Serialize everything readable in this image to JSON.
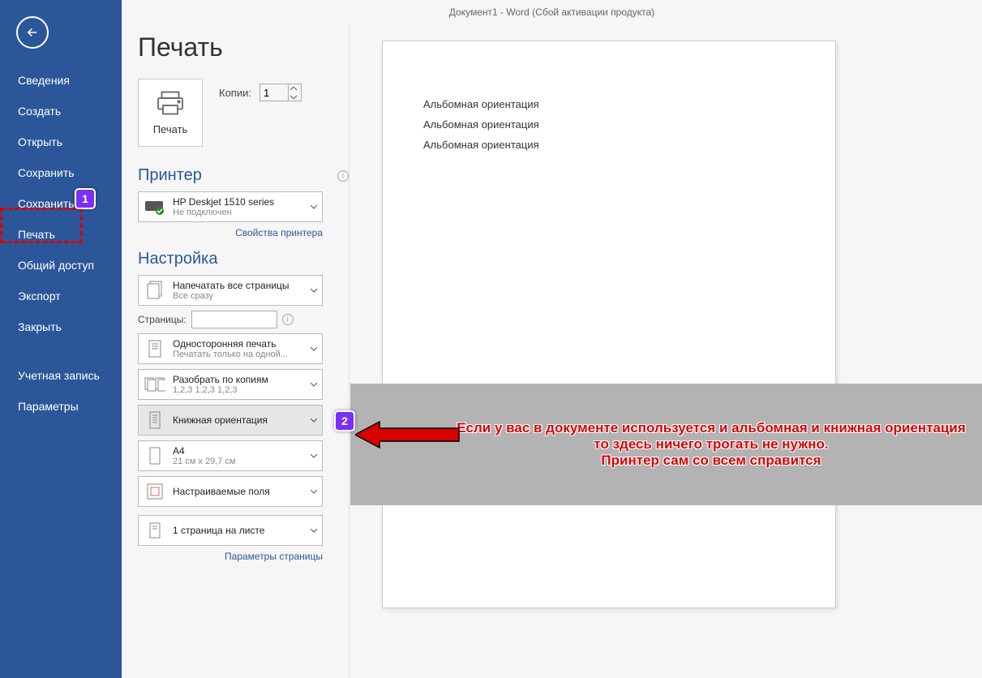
{
  "titlebar": "Документ1 - Word (Сбой активации продукта)",
  "sidebar": {
    "items": [
      "Сведения",
      "Создать",
      "Открыть",
      "Сохранить",
      "Сохранить и",
      "Печать",
      "Общий доступ",
      "Экспорт",
      "Закрыть",
      "Учетная запись",
      "Параметры"
    ]
  },
  "page": {
    "title": "Печать"
  },
  "print_button": {
    "label": "Печать"
  },
  "copies": {
    "label": "Копии:",
    "value": "1"
  },
  "printer": {
    "heading": "Принтер",
    "name": "HP Deskjet 1510 series",
    "status": "Не подключен",
    "properties_link": "Свойства принтера"
  },
  "settings": {
    "heading": "Настройка",
    "print_all": {
      "main": "Напечатать все страницы",
      "sub": "Все сразу"
    },
    "pages_label": "Страницы:",
    "pages_value": "",
    "one_side": {
      "main": "Односторонняя печать",
      "sub": "Печатать только на одной..."
    },
    "collate": {
      "main": "Разобрать по копиям",
      "sub": "1,2,3    1,2,3    1,2,3"
    },
    "orientation": {
      "main": "Книжная ориентация"
    },
    "paper": {
      "main": "A4",
      "sub": "21 см x 29,7 см"
    },
    "margins": {
      "main": "Настраиваемые поля"
    },
    "per_sheet": {
      "main": "1 страница на листе"
    },
    "page_params_link": "Параметры страницы"
  },
  "preview": {
    "lines": [
      "Альбомная ориентация",
      "Альбомная ориентация",
      "Альбомная ориентация"
    ]
  },
  "annotation": {
    "badge1": "1",
    "badge2": "2",
    "text1": "Если у вас в документе используется и альбомная и книжная ориентация",
    "text2": "то здесь ничего трогать не нужно.",
    "text3": "Принтер сам со всем справится"
  }
}
